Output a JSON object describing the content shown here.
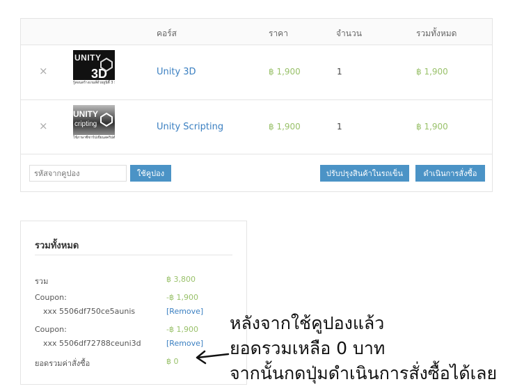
{
  "cart": {
    "headers": {
      "course": "คอร์ส",
      "price": "ราคา",
      "qty": "จำนวน",
      "total": "รวมทั้งหมด"
    },
    "items": [
      {
        "remove": "×",
        "thumb_title": "UNITY",
        "thumb_sub": "3D",
        "thumb_caption": "รู้สอนสร้างเกมส์ด้วยยูนิตี้ 3 มิติขั้นพื้นฐาน",
        "name": "Unity 3D",
        "price": "฿ 1,900",
        "qty": "1",
        "total": "฿ 1,900"
      },
      {
        "remove": "×",
        "thumb_title": "UNITY",
        "thumb_sub": "cripting",
        "thumb_caption": "ใช้ภาษาซีชาร์ปเขียนสคริปต์",
        "name": "Unity Scripting",
        "price": "฿ 1,900",
        "qty": "1",
        "total": "฿ 1,900"
      }
    ],
    "coupon_placeholder": "รหัสจากคูปอง",
    "apply_coupon": "ใช้คูปอง",
    "update_cart": "ปรับปรุงสินค้าในรถเข็น",
    "checkout": "ดำเนินการสั่งซื้อ"
  },
  "totals": {
    "title": "รวมทั้งหมด",
    "subtotal_label": "รวม",
    "subtotal_value": "฿ 3,800",
    "coupons": [
      {
        "label": "Coupon:",
        "code": "xxx 5506df750ce5aunis",
        "value": "-฿ 1,900",
        "remove": "[Remove]"
      },
      {
        "label": "Coupon:",
        "code": "xxx 5506df72788ceuni3d",
        "value": "-฿ 1,900",
        "remove": "[Remove]"
      }
    ],
    "order_total_label": "ยอดรวมค่าสั่งซื้อ",
    "order_total_value": "฿ 0"
  },
  "annotation": {
    "line1": "หลังจากใช้คูปองแล้ว",
    "line2": "ยอดรวมเหลือ 0 บาท",
    "line3": "จากนั้นกดปุ่มดำเนินการสั่งซื้อได้เลย"
  },
  "colors": {
    "link": "#3a7fc1",
    "price": "#99c16a",
    "button": "#4b93c6"
  }
}
